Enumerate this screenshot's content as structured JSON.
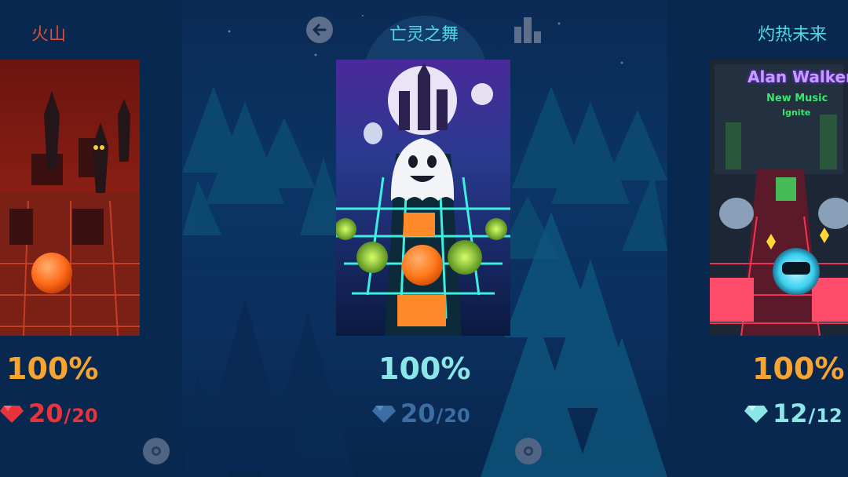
{
  "colors": {
    "orange": "#f7a430",
    "red": "#e8333c",
    "cyan": "#8be6e8",
    "muted_blue": "#3c6ea3",
    "title_cyan": "#4fd8e6",
    "title_red": "#e34b3a"
  },
  "header": {
    "back_icon": "arrow-left-icon",
    "stats_icon": "bar-chart-icon"
  },
  "levels": [
    {
      "title": "火山",
      "progress": "100%",
      "gems_current": "20",
      "gems_separator": "/",
      "gems_total": "20"
    },
    {
      "title": "亡灵之舞",
      "progress": "100%",
      "gems_current": "20",
      "gems_separator": "/",
      "gems_total": "20"
    },
    {
      "title": "灼热未来",
      "progress": "100%",
      "gems_current": "12",
      "gems_separator": "/",
      "gems_total": "12",
      "cover_text": {
        "artist": "Alan Walker",
        "subtitle": "New Music",
        "song": "Ignite"
      }
    }
  ]
}
